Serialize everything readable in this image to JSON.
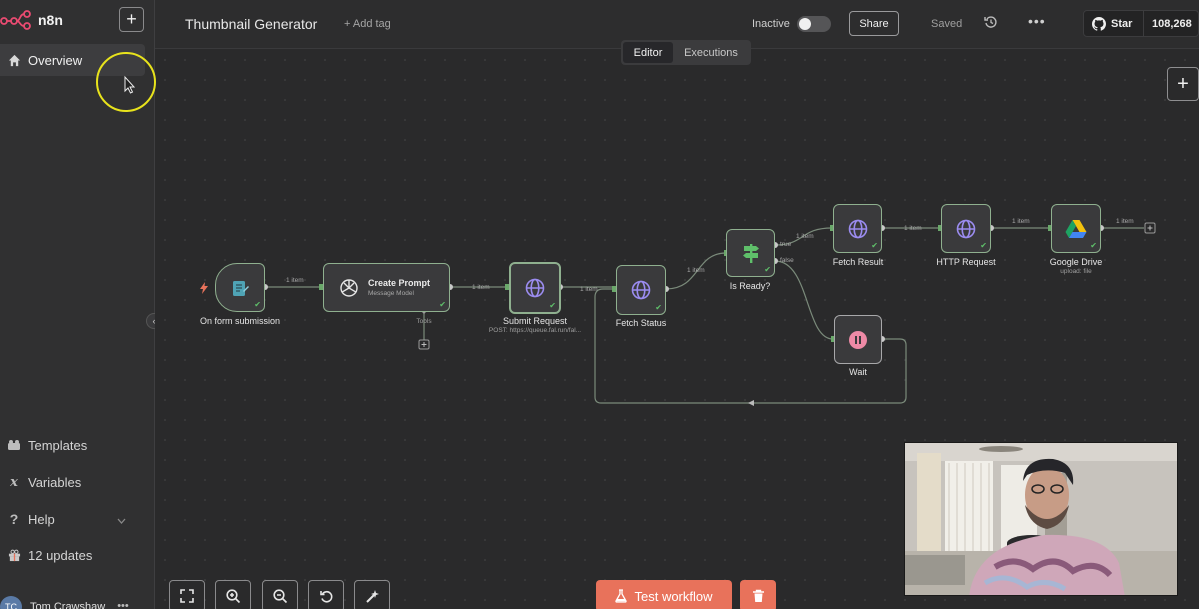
{
  "brand": {
    "name": "n8n"
  },
  "sidebar": {
    "items": [
      {
        "label": "Overview"
      },
      {
        "label": "Templates"
      },
      {
        "label": "Variables"
      },
      {
        "label": "Help"
      },
      {
        "label": "12 updates"
      }
    ],
    "user": {
      "initials": "TC",
      "name": "Tom Crawshaw"
    }
  },
  "header": {
    "title": "Thumbnail Generator",
    "add_tag": "+ Add tag",
    "status_label": "Inactive",
    "share_label": "Share",
    "saved_label": "Saved",
    "github": {
      "star_label": "Star",
      "count": "108,268"
    }
  },
  "tabs": [
    {
      "label": "Editor"
    },
    {
      "label": "Executions"
    }
  ],
  "nodes": [
    {
      "label": "On form submission"
    },
    {
      "title": "Create Prompt",
      "subtitle": "Message Model",
      "port_label": "Tools"
    },
    {
      "label": "Submit Request",
      "subtitle": "POST: https://queue.fal.run/fal..."
    },
    {
      "label": "Fetch Status"
    },
    {
      "label": "Is Ready?"
    },
    {
      "label": "Fetch Result"
    },
    {
      "label": "HTTP Request"
    },
    {
      "label": "Google Drive",
      "subtitle": "upload: file"
    },
    {
      "label": "Wait"
    }
  ],
  "edges": {
    "item_label": "1 item",
    "true_label": "true",
    "false_label": "false"
  },
  "toolbar": {
    "test_label": "Test workflow"
  },
  "colors": {
    "accent": "#e8725b",
    "success": "#5fbf6a",
    "node_border": "#8fb08f"
  }
}
